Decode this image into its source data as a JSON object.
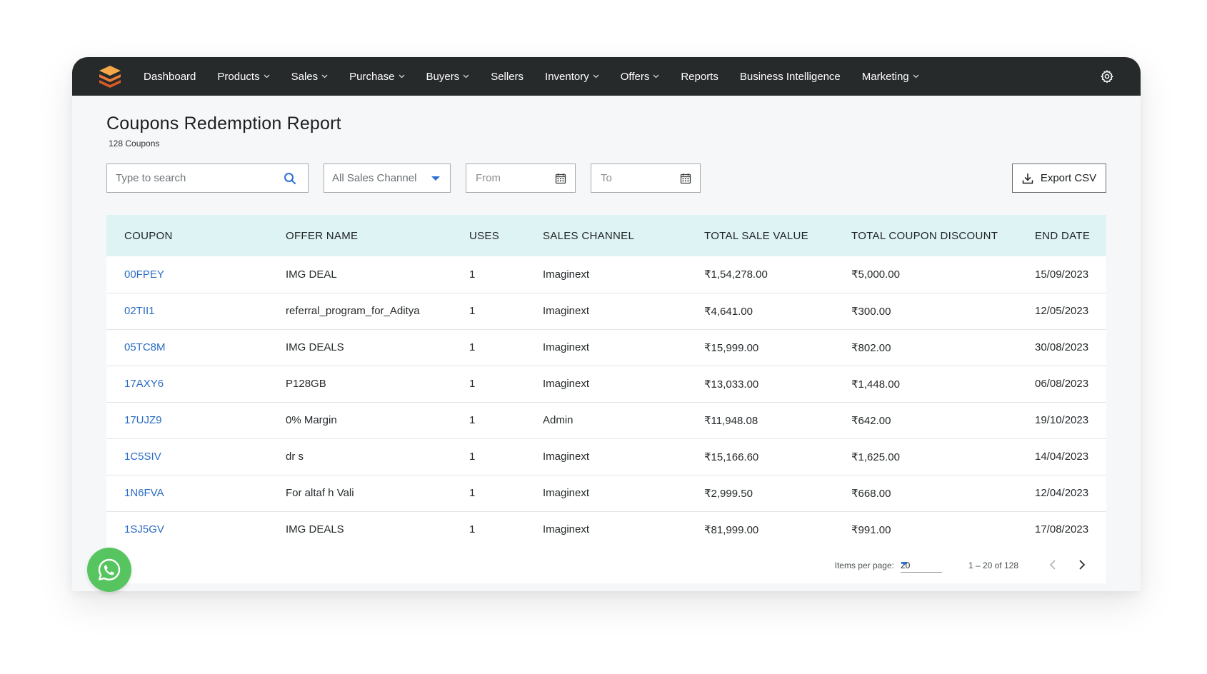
{
  "nav": {
    "items": [
      {
        "label": "Dashboard",
        "dropdown": false
      },
      {
        "label": "Products",
        "dropdown": true
      },
      {
        "label": "Sales",
        "dropdown": true
      },
      {
        "label": "Purchase",
        "dropdown": true
      },
      {
        "label": "Buyers",
        "dropdown": true
      },
      {
        "label": "Sellers",
        "dropdown": false
      },
      {
        "label": "Inventory",
        "dropdown": true
      },
      {
        "label": "Offers",
        "dropdown": true
      },
      {
        "label": "Reports",
        "dropdown": false
      },
      {
        "label": "Business Intelligence",
        "dropdown": false
      },
      {
        "label": "Marketing",
        "dropdown": true
      }
    ],
    "chevron": "⌄",
    "settings_icon": "gear-icon",
    "logo_colors": [
      "#f6a74a",
      "#ee7b35",
      "#d95a26"
    ]
  },
  "page": {
    "title": "Coupons Redemption Report",
    "subtitle": "128 Coupons"
  },
  "toolbar": {
    "search_placeholder": "Type to search",
    "channel_select": "All Sales Channel",
    "from_placeholder": "From",
    "to_placeholder": "To",
    "export_label": "Export CSV"
  },
  "table": {
    "headers": [
      "COUPON",
      "OFFER NAME",
      "USES",
      "SALES CHANNEL",
      "TOTAL SALE VALUE",
      "TOTAL COUPON DISCOUNT",
      "END DATE"
    ],
    "rows": [
      [
        "00FPEY",
        "IMG DEAL",
        "1",
        "Imaginext",
        "₹1,54,278.00",
        "₹5,000.00",
        "15/09/2023"
      ],
      [
        "02TII1",
        "referral_program_for_Aditya",
        "1",
        "Imaginext",
        "₹4,641.00",
        "₹300.00",
        "12/05/2023"
      ],
      [
        "05TC8M",
        "IMG DEALS",
        "1",
        "Imaginext",
        "₹15,999.00",
        "₹802.00",
        "30/08/2023"
      ],
      [
        "17AXY6",
        "P128GB",
        "1",
        "Imaginext",
        "₹13,033.00",
        "₹1,448.00",
        "06/08/2023"
      ],
      [
        "17UJZ9",
        "0% Margin",
        "1",
        "Admin",
        "₹11,948.08",
        "₹642.00",
        "19/10/2023"
      ],
      [
        "1C5SIV",
        "dr s",
        "1",
        "Imaginext",
        "₹15,166.60",
        "₹1,625.00",
        "14/04/2023"
      ],
      [
        "1N6FVA",
        "For altaf h Vali",
        "1",
        "Imaginext",
        "₹2,999.50",
        "₹668.00",
        "12/04/2023"
      ],
      [
        "1SJ5GV",
        "IMG DEALS",
        "1",
        "Imaginext",
        "₹81,999.00",
        "₹991.00",
        "17/08/2023"
      ]
    ]
  },
  "pagination": {
    "items_per_page_label": "Items per page:",
    "items_per_page_value": "20",
    "range_label": "1 – 20 of 128"
  },
  "colors": {
    "navbar": "#272a2b",
    "table_header": "#def3f4",
    "link": "#2b6cc4",
    "accent": "#2a6fd6",
    "whatsapp": "#56c55f"
  }
}
